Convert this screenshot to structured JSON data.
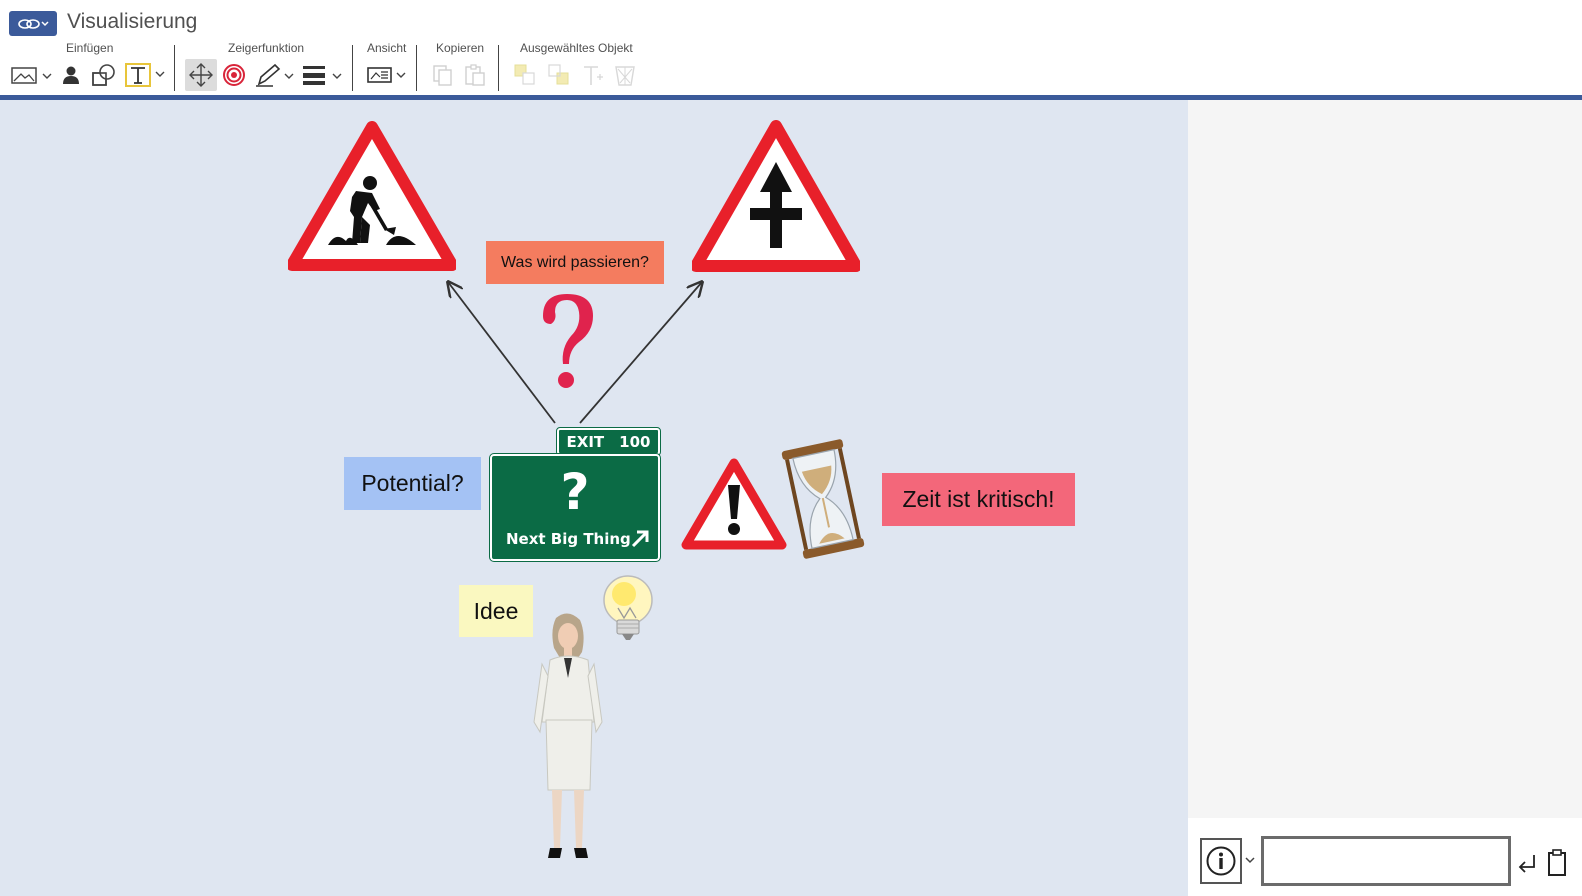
{
  "app": {
    "title": "Visualisierung"
  },
  "toolbar": {
    "groups": {
      "insert": "Einfügen",
      "pointer": "Zeigerfunktion",
      "view": "Ansicht",
      "copy": "Kopieren",
      "selected": "Ausgewähltes Objekt"
    },
    "icons": [
      "image-insert-icon",
      "person-icon",
      "shapes-icon",
      "text-icon",
      "move-icon",
      "target-icon",
      "pen-icon",
      "line-style-icon",
      "view-icon",
      "copy-icon",
      "paste-icon",
      "bring-front-icon",
      "send-back-icon",
      "text-format-icon",
      "delete-icon"
    ]
  },
  "canvas": {
    "labels": {
      "question_box": "Was wird passieren?",
      "potential": "Potential?",
      "time_critical": "Zeit ist kritisch!",
      "idea": "Idee"
    },
    "exit_sign": {
      "exit": "EXIT",
      "number": "100",
      "symbol": "?",
      "text": "Next Big Thing"
    },
    "colors": {
      "question_box": "#f47c5f",
      "potential": "#a4c2f4",
      "time_critical": "#f3677a",
      "idea": "#faf8c0",
      "sign_green": "#0b6b45",
      "sign_red": "#e8202a",
      "question_mark": "#e0234d"
    }
  },
  "bottom_bar": {
    "input_value": "",
    "icons": [
      "info-icon",
      "enter-icon",
      "clipboard-icon"
    ]
  }
}
